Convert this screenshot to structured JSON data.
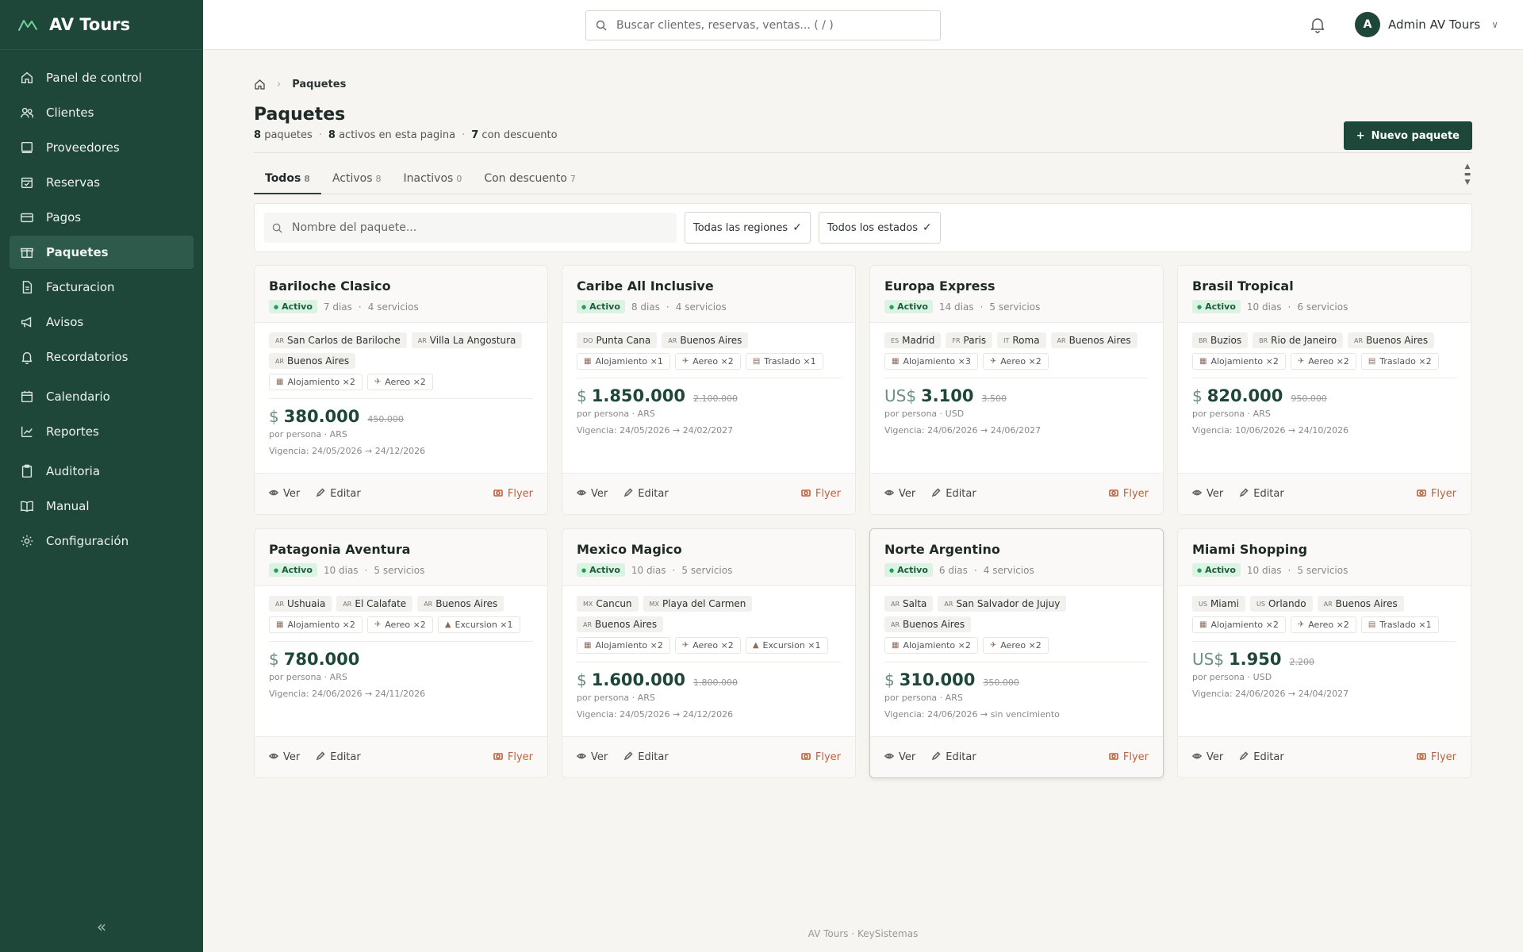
{
  "brand": {
    "name": "AV Tours"
  },
  "sidebar": {
    "items": [
      {
        "label": "Panel de control",
        "icon": "home-icon"
      },
      {
        "label": "Clientes",
        "icon": "users-icon"
      },
      {
        "label": "Proveedores",
        "icon": "book-icon"
      },
      {
        "label": "Reservas",
        "icon": "calendar-check-icon"
      },
      {
        "label": "Pagos",
        "icon": "card-icon"
      },
      {
        "label": "Paquetes",
        "icon": "gift-icon"
      },
      {
        "label": "Facturacion",
        "icon": "file-icon"
      },
      {
        "label": "Avisos",
        "icon": "megaphone-icon"
      },
      {
        "label": "Recordatorios",
        "icon": "bell-icon"
      },
      {
        "label": "Calendario",
        "icon": "calendar-icon"
      },
      {
        "label": "Reportes",
        "icon": "chart-icon"
      },
      {
        "label": "Auditoria",
        "icon": "clipboard-icon"
      },
      {
        "label": "Manual",
        "icon": "open-book-icon"
      },
      {
        "label": "Configuración",
        "icon": "gear-icon"
      }
    ],
    "collapse_label": "«"
  },
  "topbar": {
    "search_placeholder": "Buscar clientes, reservas, ventas... ( / )",
    "user_initial": "A",
    "user_name": "Admin AV Tours"
  },
  "breadcrumb": {
    "current": "Paquetes"
  },
  "page": {
    "title": "Paquetes",
    "total_count": "8",
    "total_label": "paquetes",
    "active_count": "8",
    "active_label": "activos en esta pagina",
    "discount_count": "7",
    "discount_label": "con descuento",
    "new_button": "Nuevo paquete"
  },
  "tabs": [
    {
      "label": "Todos",
      "count": "8"
    },
    {
      "label": "Activos",
      "count": "8"
    },
    {
      "label": "Inactivos",
      "count": "0"
    },
    {
      "label": "Con descuento",
      "count": "7"
    }
  ],
  "filters": {
    "name_placeholder": "Nombre del paquete...",
    "region": "Todas las regiones",
    "status": "Todos los estados"
  },
  "actions": {
    "view": "Ver",
    "edit": "Editar",
    "flyer": "Flyer"
  },
  "packages": [
    {
      "name": "Bariloche Clasico",
      "status": "Activo",
      "days": "7 dias",
      "services": "4 servicios",
      "destinations": [
        [
          "AR",
          "San Carlos de Bariloche"
        ],
        [
          "AR",
          "Villa La Angostura"
        ],
        [
          "AR",
          "Buenos Aires"
        ]
      ],
      "items": [
        [
          "hotel",
          "Alojamiento ×2"
        ],
        [
          "plane",
          "Aereo ×2"
        ]
      ],
      "currency": "$",
      "price": "380.000",
      "old_price": "450.000",
      "per": "por persona · ARS",
      "validity": "Vigencia: 24/05/2026 → 24/12/2026"
    },
    {
      "name": "Caribe All Inclusive",
      "status": "Activo",
      "days": "8 dias",
      "services": "4 servicios",
      "destinations": [
        [
          "DO",
          "Punta Cana"
        ],
        [
          "AR",
          "Buenos Aires"
        ]
      ],
      "items": [
        [
          "hotel",
          "Alojamiento ×1"
        ],
        [
          "plane",
          "Aereo ×2"
        ],
        [
          "bus",
          "Traslado ×1"
        ]
      ],
      "currency": "$",
      "price": "1.850.000",
      "old_price": "2.100.000",
      "per": "por persona · ARS",
      "validity": "Vigencia: 24/05/2026 → 24/02/2027"
    },
    {
      "name": "Europa Express",
      "status": "Activo",
      "days": "14 dias",
      "services": "5 servicios",
      "destinations": [
        [
          "ES",
          "Madrid"
        ],
        [
          "FR",
          "Paris"
        ],
        [
          "IT",
          "Roma"
        ],
        [
          "AR",
          "Buenos Aires"
        ]
      ],
      "items": [
        [
          "hotel",
          "Alojamiento ×3"
        ],
        [
          "plane",
          "Aereo ×2"
        ]
      ],
      "currency": "US$",
      "price": "3.100",
      "old_price": "3.500",
      "per": "por persona · USD",
      "validity": "Vigencia: 24/06/2026 → 24/06/2027"
    },
    {
      "name": "Brasil Tropical",
      "status": "Activo",
      "days": "10 dias",
      "services": "6 servicios",
      "destinations": [
        [
          "BR",
          "Buzios"
        ],
        [
          "BR",
          "Rio de Janeiro"
        ],
        [
          "AR",
          "Buenos Aires"
        ]
      ],
      "items": [
        [
          "hotel",
          "Alojamiento ×2"
        ],
        [
          "plane",
          "Aereo ×2"
        ],
        [
          "bus",
          "Traslado ×2"
        ]
      ],
      "currency": "$",
      "price": "820.000",
      "old_price": "950.000",
      "per": "por persona · ARS",
      "validity": "Vigencia: 10/06/2026 → 24/10/2026"
    },
    {
      "name": "Patagonia Aventura",
      "status": "Activo",
      "days": "10 dias",
      "services": "5 servicios",
      "destinations": [
        [
          "AR",
          "Ushuaia"
        ],
        [
          "AR",
          "El Calafate"
        ],
        [
          "AR",
          "Buenos Aires"
        ]
      ],
      "items": [
        [
          "hotel",
          "Alojamiento ×2"
        ],
        [
          "plane",
          "Aereo ×2"
        ],
        [
          "tour",
          "Excursion ×1"
        ]
      ],
      "currency": "$",
      "price": "780.000",
      "old_price": "",
      "per": "por persona · ARS",
      "validity": "Vigencia: 24/06/2026 → 24/11/2026"
    },
    {
      "name": "Mexico Magico",
      "status": "Activo",
      "days": "10 dias",
      "services": "5 servicios",
      "destinations": [
        [
          "MX",
          "Cancun"
        ],
        [
          "MX",
          "Playa del Carmen"
        ],
        [
          "AR",
          "Buenos Aires"
        ]
      ],
      "items": [
        [
          "hotel",
          "Alojamiento ×2"
        ],
        [
          "plane",
          "Aereo ×2"
        ],
        [
          "tour",
          "Excursion ×1"
        ]
      ],
      "currency": "$",
      "price": "1.600.000",
      "old_price": "1.800.000",
      "per": "por persona · ARS",
      "validity": "Vigencia: 24/05/2026 → 24/12/2026"
    },
    {
      "name": "Norte Argentino",
      "status": "Activo",
      "days": "6 dias",
      "services": "4 servicios",
      "destinations": [
        [
          "AR",
          "Salta"
        ],
        [
          "AR",
          "San Salvador de Jujuy"
        ],
        [
          "AR",
          "Buenos Aires"
        ]
      ],
      "items": [
        [
          "hotel",
          "Alojamiento ×2"
        ],
        [
          "plane",
          "Aereo ×2"
        ]
      ],
      "currency": "$",
      "price": "310.000",
      "old_price": "350.000",
      "per": "por persona · ARS",
      "validity": "Vigencia: 24/06/2026 → sin vencimiento"
    },
    {
      "name": "Miami Shopping",
      "status": "Activo",
      "days": "10 dias",
      "services": "5 servicios",
      "destinations": [
        [
          "US",
          "Miami"
        ],
        [
          "US",
          "Orlando"
        ],
        [
          "AR",
          "Buenos Aires"
        ]
      ],
      "items": [
        [
          "hotel",
          "Alojamiento ×2"
        ],
        [
          "plane",
          "Aereo ×2"
        ],
        [
          "bus",
          "Traslado ×1"
        ]
      ],
      "currency": "US$",
      "price": "1.950",
      "old_price": "2.200",
      "per": "por persona · USD",
      "validity": "Vigencia: 24/06/2026 → 24/04/2027"
    }
  ],
  "footer": {
    "text": "AV Tours · KeySistemas"
  },
  "colors": {
    "sidebar": "#1e4639",
    "accent": "#1e4639",
    "active_badge": "#daf3e3",
    "flyer": "#c0603a"
  }
}
